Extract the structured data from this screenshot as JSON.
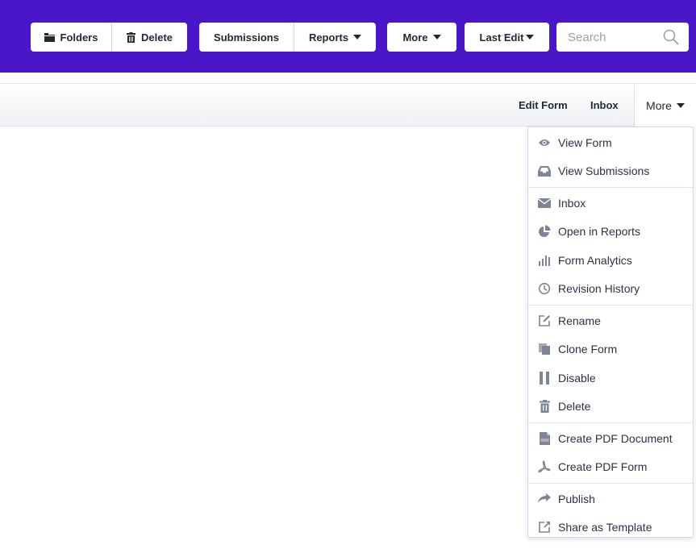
{
  "toolbar": {
    "folders": "Folders",
    "delete": "Delete",
    "submissions": "Submissions",
    "reports": "Reports",
    "more": "More",
    "last_edit": "Last Edit",
    "search_placeholder": "Search"
  },
  "subbar": {
    "edit_form": "Edit Form",
    "inbox": "Inbox",
    "more": "More"
  },
  "menu": {
    "sections": [
      [
        {
          "label": "View Form",
          "icon": "eye-icon"
        },
        {
          "label": "View Submissions",
          "icon": "tray-icon"
        }
      ],
      [
        {
          "label": "Inbox",
          "icon": "envelope-icon"
        },
        {
          "label": "Open in Reports",
          "icon": "pie-chart-icon"
        },
        {
          "label": "Form Analytics",
          "icon": "bar-chart-icon"
        },
        {
          "label": "Revision History",
          "icon": "clock-icon"
        }
      ],
      [
        {
          "label": "Rename",
          "icon": "edit-icon"
        },
        {
          "label": "Clone Form",
          "icon": "copy-icon"
        },
        {
          "label": "Disable",
          "icon": "pause-icon"
        },
        {
          "label": "Delete",
          "icon": "trash-icon"
        }
      ],
      [
        {
          "label": "Create PDF Document",
          "icon": "pdf-file-icon"
        },
        {
          "label": "Create PDF Form",
          "icon": "acrobat-icon"
        }
      ],
      [
        {
          "label": "Publish",
          "icon": "share-arrow-icon"
        },
        {
          "label": "Share as Template",
          "icon": "external-share-icon"
        }
      ]
    ]
  },
  "colors": {
    "toolbar_bg": "#4a16c9",
    "icon_gray": "#7d8596"
  }
}
